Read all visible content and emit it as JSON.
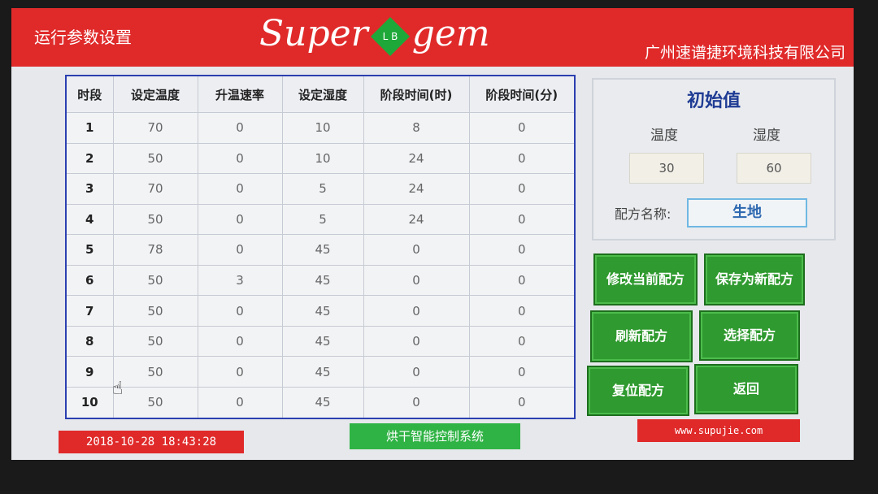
{
  "header": {
    "screen_title": "运行参数设置",
    "brand_left": "Super",
    "brand_gem_letters": "L B",
    "brand_right": "gem",
    "company": "广州速谱捷环境科技有限公司"
  },
  "table": {
    "headers": [
      "时段",
      "设定温度",
      "升温速率",
      "设定湿度",
      "阶段时间(时)",
      "阶段时间(分)"
    ],
    "rows": [
      [
        "1",
        "70",
        "0",
        "10",
        "8",
        "0"
      ],
      [
        "2",
        "50",
        "0",
        "10",
        "24",
        "0"
      ],
      [
        "3",
        "70",
        "0",
        "5",
        "24",
        "0"
      ],
      [
        "4",
        "50",
        "0",
        "5",
        "24",
        "0"
      ],
      [
        "5",
        "78",
        "0",
        "45",
        "0",
        "0"
      ],
      [
        "6",
        "50",
        "3",
        "45",
        "0",
        "0"
      ],
      [
        "7",
        "50",
        "0",
        "45",
        "0",
        "0"
      ],
      [
        "8",
        "50",
        "0",
        "45",
        "0",
        "0"
      ],
      [
        "9",
        "50",
        "0",
        "45",
        "0",
        "0"
      ],
      [
        "10",
        "50",
        "0",
        "45",
        "0",
        "0"
      ]
    ]
  },
  "initial": {
    "title": "初始值",
    "temp_label": "温度",
    "humidity_label": "湿度",
    "temp_value": "30",
    "humidity_value": "60",
    "recipe_label": "配方名称:",
    "recipe_name": "生地"
  },
  "buttons": {
    "modify": "修改当前配方",
    "save_new": "保存为新配方",
    "refresh": "刷新配方",
    "select": "选择配方",
    "reset": "复位配方",
    "back": "返回"
  },
  "footer": {
    "datetime": "2018-10-28 18:43:28",
    "system_name": "烘干智能控制系统",
    "website": "www.supujie.com"
  }
}
